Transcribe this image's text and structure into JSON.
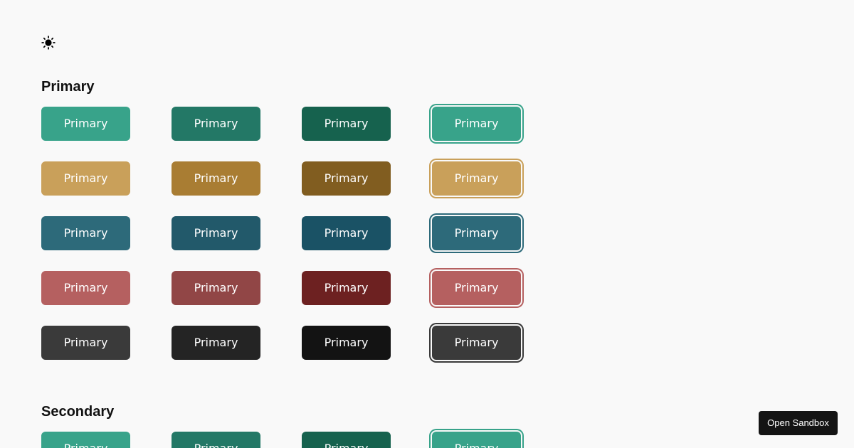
{
  "theme_toggle": {
    "icon": "sun-icon"
  },
  "sections": [
    {
      "title": "Primary",
      "rows": [
        {
          "variant": "green",
          "states": [
            {
              "label": "Primary",
              "bg": "#38a38a",
              "ring": "#38a38a"
            },
            {
              "label": "Primary",
              "bg": "#237866"
            },
            {
              "label": "Primary",
              "bg": "#16624e"
            },
            {
              "label": "Primary",
              "bg": "#38a38a",
              "ring": "#38a38a",
              "focus": true
            }
          ]
        },
        {
          "variant": "gold",
          "states": [
            {
              "label": "Primary",
              "bg": "#c9a05a"
            },
            {
              "label": "Primary",
              "bg": "#a97d33"
            },
            {
              "label": "Primary",
              "bg": "#815d20"
            },
            {
              "label": "Primary",
              "bg": "#c9a05a",
              "ring": "#c9a05a",
              "focus": true
            }
          ]
        },
        {
          "variant": "teal",
          "states": [
            {
              "label": "Primary",
              "bg": "#2d6a7a"
            },
            {
              "label": "Primary",
              "bg": "#22596a"
            },
            {
              "label": "Primary",
              "bg": "#1a5265"
            },
            {
              "label": "Primary",
              "bg": "#2d6a7a",
              "ring": "#2d6a7a",
              "focus": true
            }
          ]
        },
        {
          "variant": "red",
          "states": [
            {
              "label": "Primary",
              "bg": "#b56060"
            },
            {
              "label": "Primary",
              "bg": "#914646"
            },
            {
              "label": "Primary",
              "bg": "#6d2121"
            },
            {
              "label": "Primary",
              "bg": "#b56060",
              "ring": "#b56060",
              "focus": true
            }
          ]
        },
        {
          "variant": "dark",
          "states": [
            {
              "label": "Primary",
              "bg": "#3a3a3a"
            },
            {
              "label": "Primary",
              "bg": "#242424"
            },
            {
              "label": "Primary",
              "bg": "#131313"
            },
            {
              "label": "Primary",
              "bg": "#3a3a3a",
              "ring": "#3a3a3a",
              "focus": true
            }
          ]
        }
      ]
    },
    {
      "title": "Secondary",
      "rows": [
        {
          "variant": "green",
          "states": [
            {
              "label": "Primary",
              "bg": "#38a38a"
            },
            {
              "label": "Primary",
              "bg": "#237866"
            },
            {
              "label": "Primary",
              "bg": "#16624e"
            },
            {
              "label": "Primary",
              "bg": "#38a38a",
              "ring": "#38a38a",
              "focus": true
            }
          ]
        }
      ]
    }
  ],
  "sandbox_button": {
    "label": "Open Sandbox"
  }
}
